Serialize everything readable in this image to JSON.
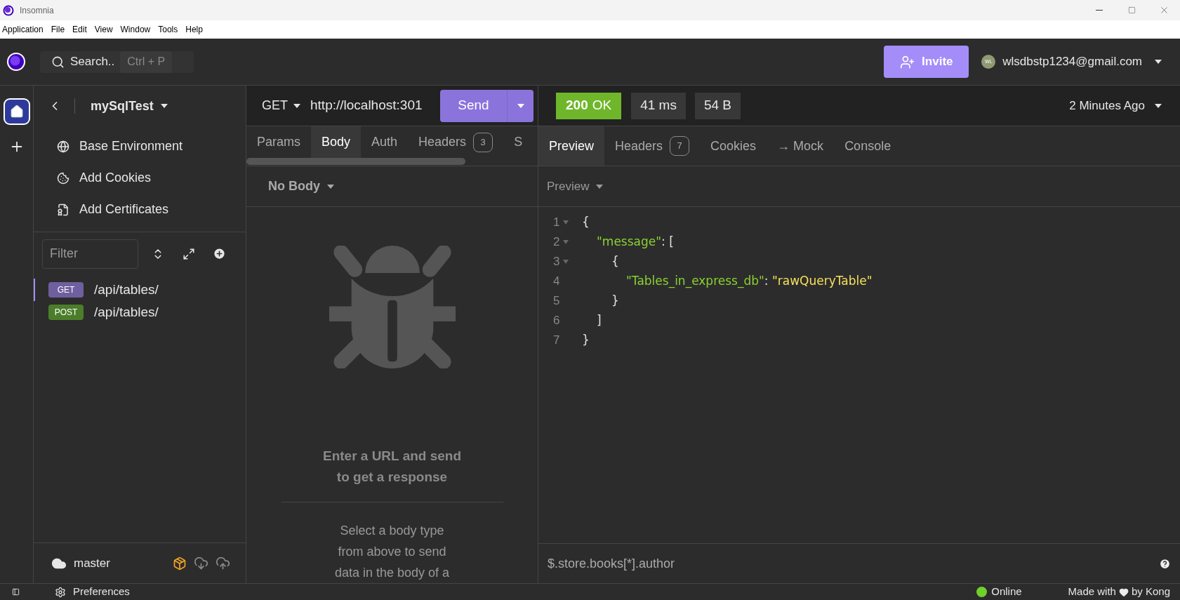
{
  "window": {
    "title": "Insomnia"
  },
  "menu": [
    "Application",
    "File",
    "Edit",
    "View",
    "Window",
    "Tools",
    "Help"
  ],
  "topbar": {
    "search": {
      "label": "Search..",
      "shortcut": "Ctrl + P"
    },
    "invite": "Invite",
    "avatar": "WL",
    "user": "wlsdbstp1234@gmail.com"
  },
  "rail": [
    {
      "kind": "home",
      "selected": true
    },
    {
      "kind": "add",
      "selected": false
    }
  ],
  "sidebar": {
    "project": "mySqlTest",
    "items": [
      {
        "kind": "globe",
        "label": "Base Environment"
      },
      {
        "kind": "cookie",
        "label": "Add Cookies"
      },
      {
        "kind": "certificate",
        "label": "Add Certificates"
      }
    ],
    "filter": {
      "placeholder": "Filter"
    },
    "requests": [
      {
        "method": "GET",
        "color": "#6f5f9f",
        "path": "/api/tables/",
        "selected": true
      },
      {
        "method": "POST",
        "color": "#4b7d2a",
        "path": "/api/tables/",
        "selected": false
      }
    ],
    "branch": "master"
  },
  "request": {
    "method": "GET",
    "url": "http://localhost:301",
    "send": "Send",
    "tabs": [
      {
        "label": "Params",
        "selected": false
      },
      {
        "label": "Body",
        "selected": true
      },
      {
        "label": "Auth",
        "selected": false
      },
      {
        "label": "Headers",
        "count": "3",
        "selected": false
      },
      {
        "label": "S",
        "selected": false
      }
    ],
    "body_type": "No Body",
    "empty_title": "Enter a URL and send to get a response",
    "empty_hint": "Select a body type from above to send data in the body of a"
  },
  "response": {
    "status": {
      "code": "200",
      "text": "OK"
    },
    "time": "41 ms",
    "size": "54 B",
    "age": "2 Minutes Ago",
    "tabs": [
      {
        "label": "Preview",
        "selected": true
      },
      {
        "label": "Headers",
        "count": "7",
        "selected": false
      },
      {
        "label": "Cookies",
        "selected": false
      },
      {
        "label": "→ Mock",
        "selected": false
      },
      {
        "label": "Console",
        "selected": false
      }
    ],
    "view": "Preview",
    "lines": [
      {
        "number": "1",
        "foldable": true,
        "tokens": [
          {
            "kind": "punct",
            "text": "{"
          }
        ],
        "children": [
          {
            "number": "2",
            "foldable": true,
            "tokens": [
              {
                "kind": "key",
                "text": "\"message\""
              },
              {
                "kind": "punct",
                "text": ": ["
              }
            ],
            "children": [
              {
                "number": "3",
                "foldable": true,
                "tokens": [
                  {
                    "kind": "punct",
                    "text": "{"
                  }
                ],
                "children": [
                  {
                    "number": "4",
                    "foldable": false,
                    "tokens": [
                      {
                        "kind": "key",
                        "text": "\"Tables_in_express_db\""
                      },
                      {
                        "kind": "punct",
                        "text": ": "
                      },
                      {
                        "kind": "string",
                        "text": "\"rawQueryTable\""
                      }
                    ]
                  }
                ]
              },
              {
                "number": "5",
                "foldable": false,
                "tokens": [
                  {
                    "kind": "punct",
                    "text": "}"
                  }
                ]
              }
            ]
          },
          {
            "number": "6",
            "foldable": false,
            "tokens": [
              {
                "kind": "punct",
                "text": "]"
              }
            ]
          }
        ]
      },
      {
        "number": "7",
        "foldable": false,
        "tokens": [
          {
            "kind": "punct",
            "text": "}"
          }
        ]
      }
    ],
    "filter": {
      "placeholder": "$.store.books[*].author"
    }
  },
  "status_bar": {
    "preferences": "Preferences",
    "online": "Online",
    "made_with": "Made with",
    "by": "by Kong"
  }
}
